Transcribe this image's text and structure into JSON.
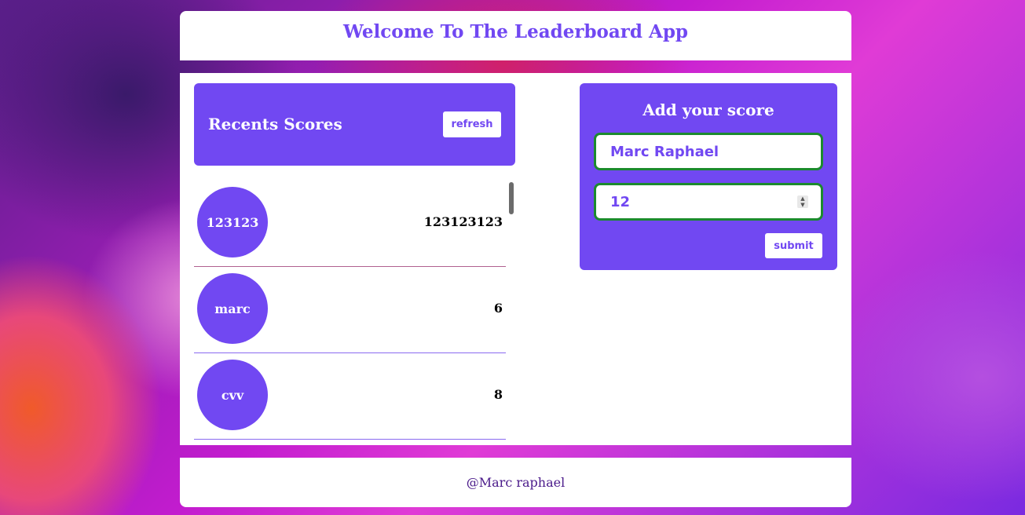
{
  "header": {
    "title": "Welcome To The Leaderboard App"
  },
  "scores": {
    "heading": "Recents Scores",
    "refresh_label": "refresh",
    "items": [
      {
        "user": "123123",
        "score": "123123123"
      },
      {
        "user": "marc",
        "score": "6"
      },
      {
        "user": "cvv",
        "score": "8"
      }
    ]
  },
  "form": {
    "heading": "Add your score",
    "name_value": "Marc Raphael",
    "score_value": "12",
    "submit_label": "submit"
  },
  "footer": {
    "text": "@Marc raphael"
  }
}
